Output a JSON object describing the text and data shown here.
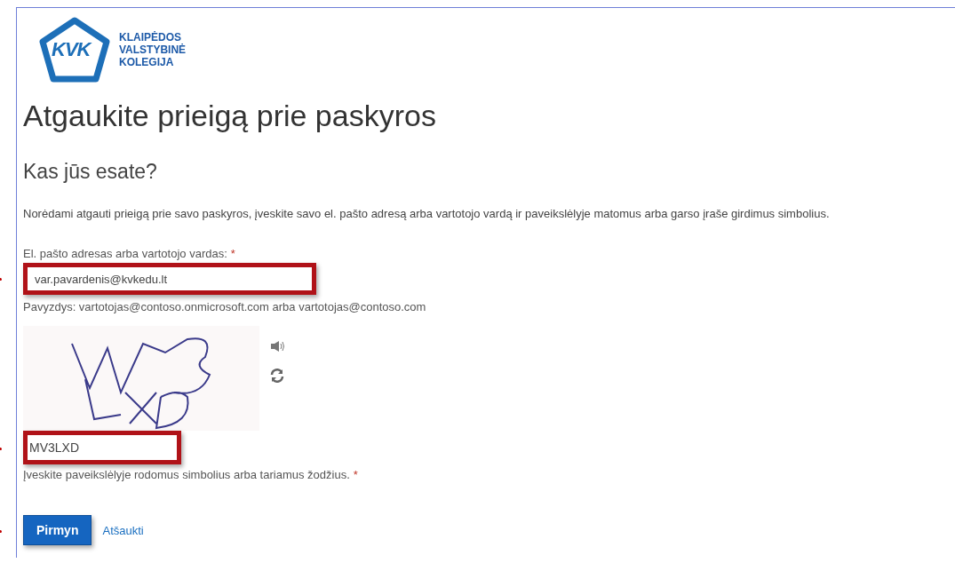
{
  "logo": {
    "mark": "KVK",
    "lines": [
      "KLAIPĖDOS",
      "VALSTYBINĖ",
      "KOLEGIJA"
    ]
  },
  "title": "Atgaukite prieigą prie paskyros",
  "subtitle": "Kas jūs esate?",
  "description": "Norėdami atgauti prieigą prie savo paskyros, įveskite savo el. pašto adresą arba vartotojo vardą ir paveikslėlyje matomus arba garso įraše girdimus simbolius.",
  "email_field": {
    "label": "El. pašto adresas arba vartotojo vardas:",
    "required_mark": "*",
    "value": "var.pavardenis@kvkedu.lt",
    "highlighted": true
  },
  "example": "Pavyzdys: vartotojas@contoso.onmicrosoft.com arba vartotojas@contoso.com",
  "captcha_field": {
    "value": "MV3LXD",
    "hint": "Įveskite paveikslėlyje rodomus simbolius arba tariamus žodžius.",
    "required_mark": "*",
    "highlighted": true
  },
  "buttons": [
    {
      "kind": "primary",
      "label": "Pirmyn",
      "highlighted": true
    },
    {
      "kind": "link",
      "label": "Atšaukti",
      "highlighted": false
    }
  ]
}
